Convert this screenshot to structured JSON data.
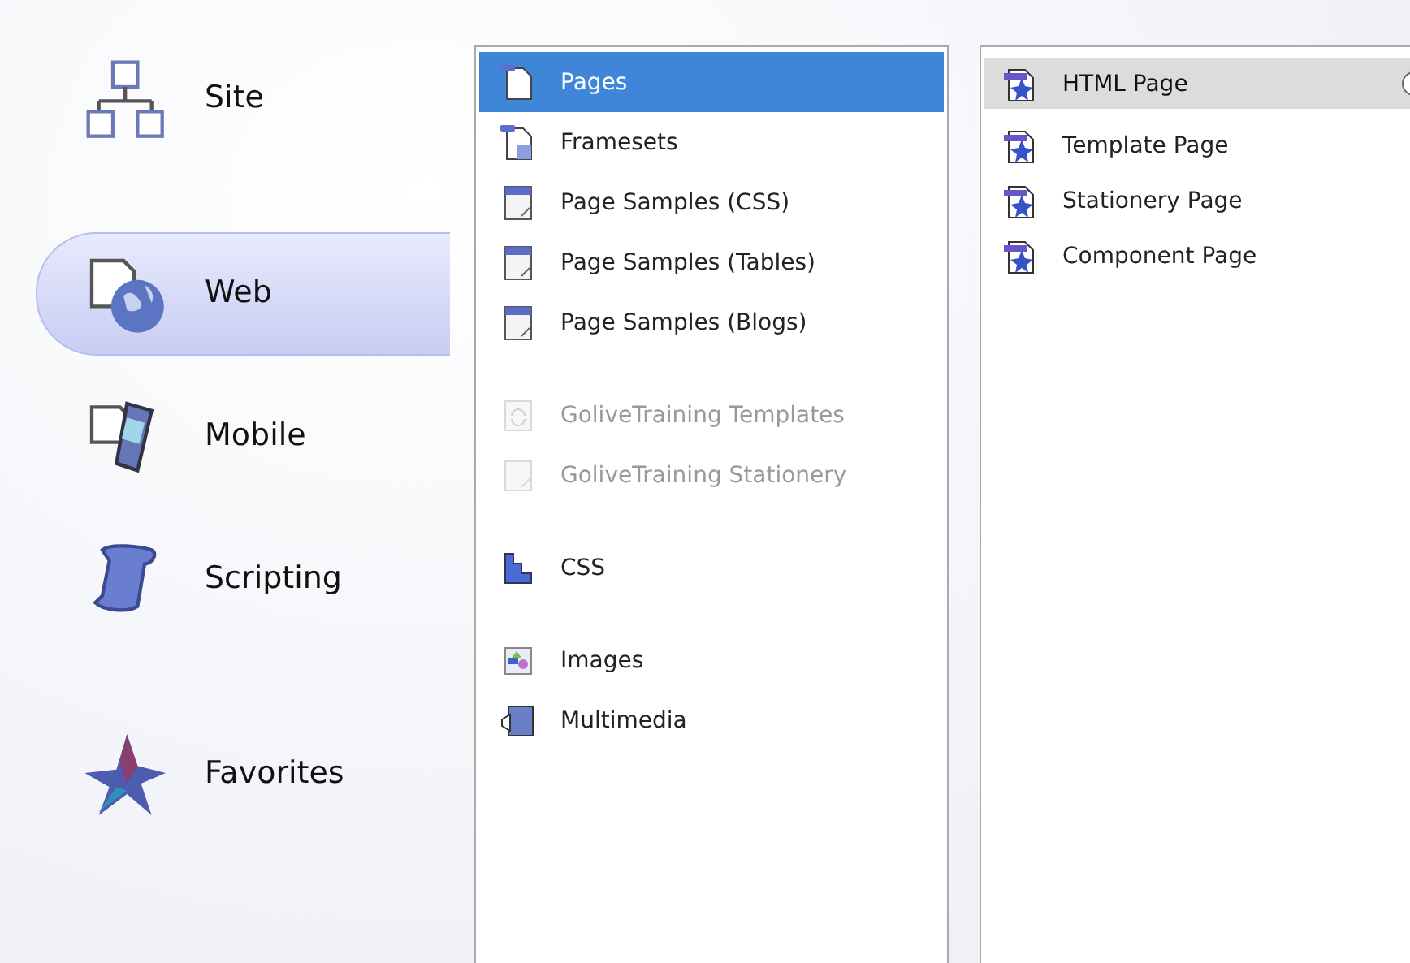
{
  "categories": [
    [
      {
        "label": "Site",
        "kind": "site",
        "selected": false
      }
    ],
    [
      {
        "label": "Web",
        "kind": "web",
        "selected": true
      },
      {
        "label": "Mobile",
        "kind": "mobile",
        "selected": false
      },
      {
        "label": "Scripting",
        "kind": "scripting",
        "selected": false
      }
    ],
    [
      {
        "label": "Favorites",
        "kind": "favorites",
        "selected": false
      }
    ]
  ],
  "types": [
    [
      {
        "label": "Pages",
        "kind": "page",
        "selected": true,
        "disabled": false
      },
      {
        "label": "Framesets",
        "kind": "frameset",
        "selected": false,
        "disabled": false
      },
      {
        "label": "Page Samples (CSS)",
        "kind": "sample",
        "selected": false,
        "disabled": false
      },
      {
        "label": "Page Samples (Tables)",
        "kind": "sample",
        "selected": false,
        "disabled": false
      },
      {
        "label": "Page Samples (Blogs)",
        "kind": "sample",
        "selected": false,
        "disabled": false
      }
    ],
    [
      {
        "label": "GoliveTraining Templates",
        "kind": "template",
        "selected": false,
        "disabled": true
      },
      {
        "label": "GoliveTraining Stationery",
        "kind": "stationery",
        "selected": false,
        "disabled": true
      }
    ],
    [
      {
        "label": "CSS",
        "kind": "css",
        "selected": false,
        "disabled": false
      }
    ],
    [
      {
        "label": "Images",
        "kind": "images",
        "selected": false,
        "disabled": false
      },
      {
        "label": "Multimedia",
        "kind": "multimedia",
        "selected": false,
        "disabled": false
      }
    ]
  ],
  "documents": {
    "header": {
      "label": "HTML Page",
      "selected": true
    },
    "items": [
      {
        "label": "Template Page"
      },
      {
        "label": "Stationery Page"
      },
      {
        "label": "Component Page"
      }
    ]
  }
}
